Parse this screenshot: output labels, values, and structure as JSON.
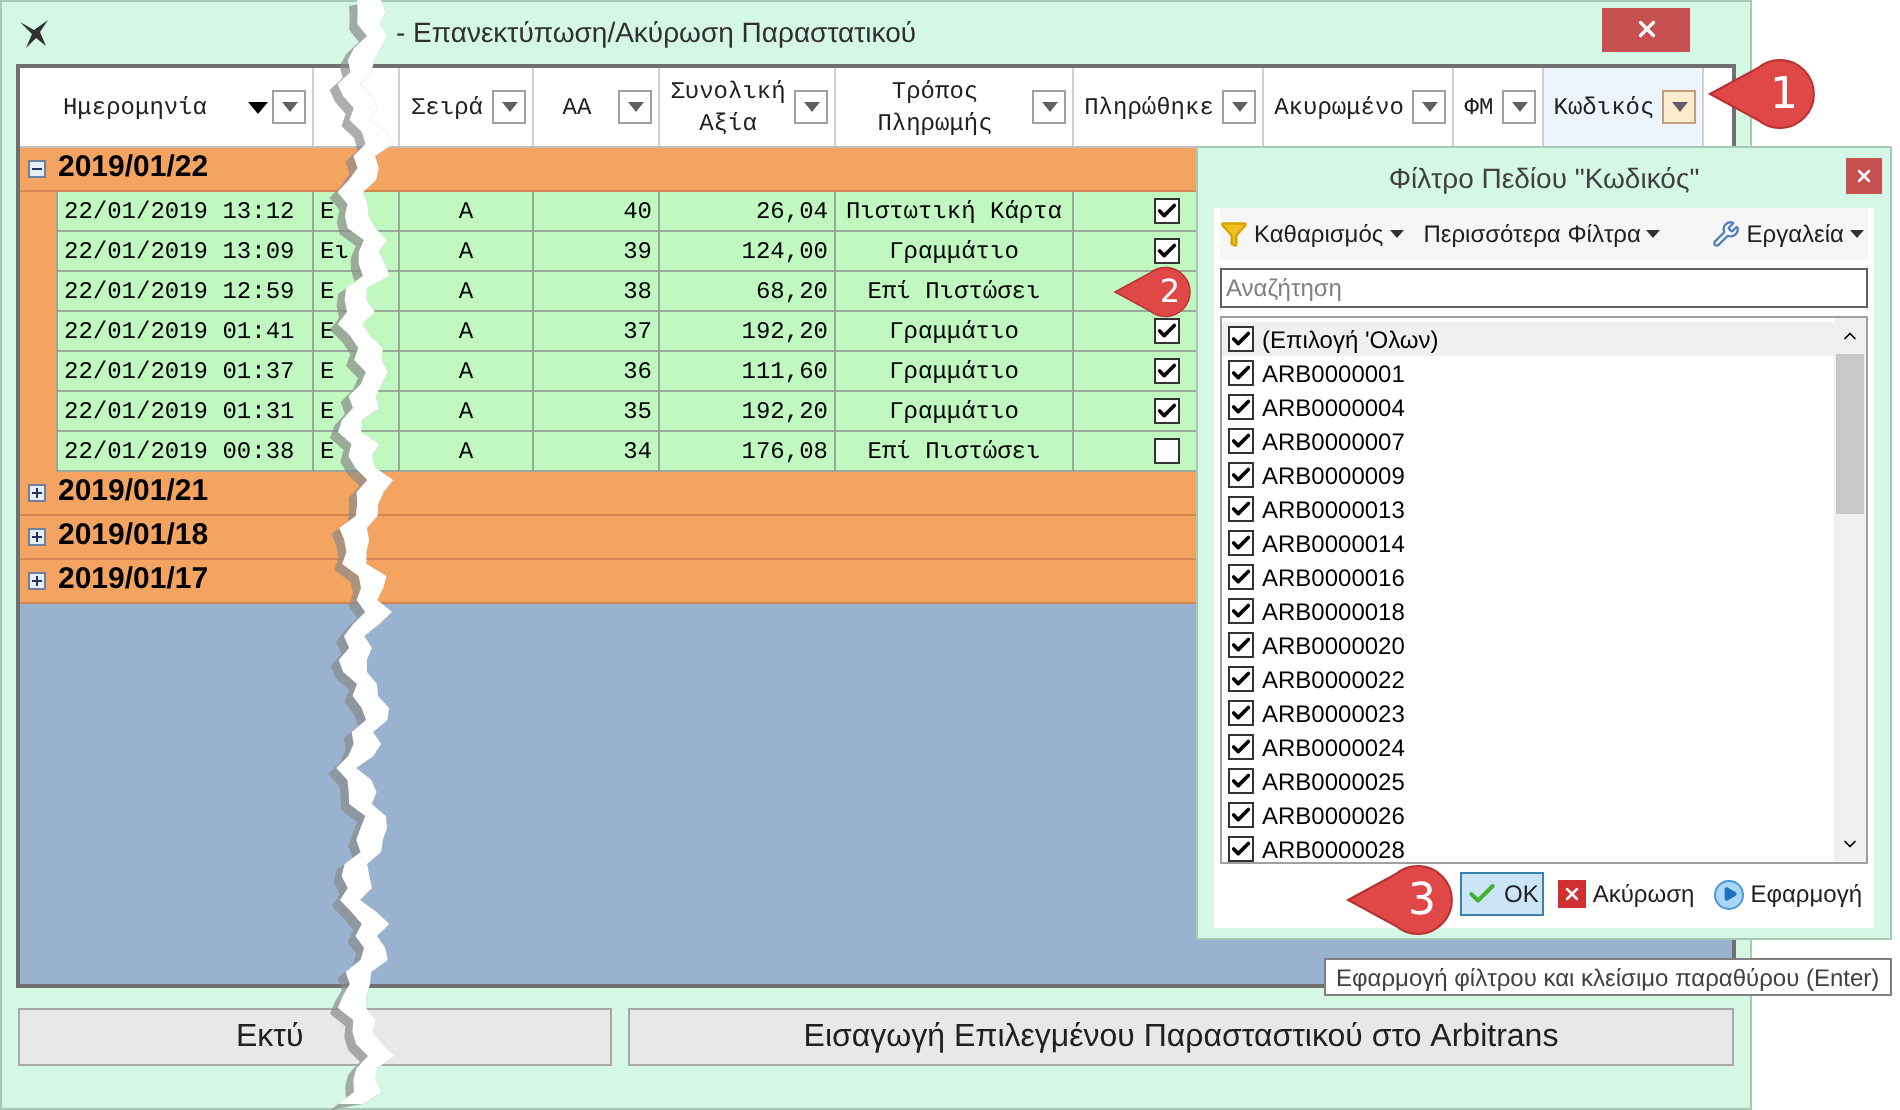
{
  "window": {
    "title": "- Επανεκτύπωση/Ακύρωση Παραστατικού"
  },
  "columns": [
    {
      "label": "Ημερομηνία",
      "sorted": true,
      "filter_open": false
    },
    {
      "label": "Σειρά",
      "sorted": false,
      "filter_open": false
    },
    {
      "label": "ΑΑ",
      "sorted": false,
      "filter_open": false
    },
    {
      "label": "Συνολική Αξία",
      "sorted": false,
      "filter_open": false
    },
    {
      "label": "Τρόπος Πληρωμής",
      "sorted": false,
      "filter_open": false
    },
    {
      "label": "Πληρώθηκε",
      "sorted": false,
      "filter_open": false
    },
    {
      "label": "Ακυρωμένο",
      "sorted": false,
      "filter_open": false
    },
    {
      "label": "ΦΜ",
      "sorted": false,
      "filter_open": false
    },
    {
      "label": "Κωδικός",
      "sorted": false,
      "filter_open": true
    }
  ],
  "groups": [
    {
      "label": "2019/01/22",
      "expanded": true,
      "rows": [
        {
          "date": "22/01/2019 13:12",
          "column_2": "Ε",
          "series": "Α",
          "number": "40",
          "total": "26,04",
          "payment": "Πιστωτική Κάρτα",
          "paid": true
        },
        {
          "date": "22/01/2019 13:09",
          "column_2": "Ει",
          "series": "Α",
          "number": "39",
          "total": "124,00",
          "payment": "Γραμμάτιο",
          "paid": true
        },
        {
          "date": "22/01/2019 12:59",
          "column_2": "Ε",
          "series": "Α",
          "number": "38",
          "total": "68,20",
          "payment": "Επί Πιστώσει"
        },
        {
          "date": "22/01/2019 01:41",
          "column_2": "Ε",
          "series": "Α",
          "number": "37",
          "total": "192,20",
          "payment": "Γραμμάτιο",
          "paid": true
        },
        {
          "date": "22/01/2019 01:37",
          "column_2": "Ε",
          "series": "Α",
          "number": "36",
          "total": "111,60",
          "payment": "Γραμμάτιο",
          "paid": true
        },
        {
          "date": "22/01/2019 01:31",
          "column_2": "Ε",
          "series": "Α",
          "number": "35",
          "total": "192,20",
          "payment": "Γραμμάτιο",
          "paid": true
        },
        {
          "date": "22/01/2019 00:38",
          "column_2": "Ε",
          "series": "Α",
          "number": "34",
          "total": "176,08",
          "payment": "Επί Πιστώσει",
          "paid": false
        }
      ]
    },
    {
      "label": "2019/01/21",
      "expanded": false
    },
    {
      "label": "2019/01/18",
      "expanded": false
    },
    {
      "label": "2019/01/17",
      "expanded": false
    }
  ],
  "buttons": [
    "Εκτύ",
    "Εισαγωγή Επιλεγμένου Παρασταστικού στο Arbitrans"
  ],
  "filter_popup": {
    "title": "Φίλτρο Πεδίου \"Κωδικός\"",
    "toolbar": [
      "Καθαρισμός",
      "Περισσότερα Φίλτρα",
      "Εργαλεία"
    ],
    "search": {
      "placeholder": "Αναζήτηση"
    },
    "items": [
      {
        "label": "(Επιλογή 'Ολων)",
        "checked": true
      },
      {
        "label": "ARB0000001",
        "checked": true
      },
      {
        "label": "ARB0000004",
        "checked": true
      },
      {
        "label": "ARB0000007",
        "checked": true
      },
      {
        "label": "ARB0000009",
        "checked": true
      },
      {
        "label": "ARB0000013",
        "checked": true
      },
      {
        "label": "ARB0000014",
        "checked": true
      },
      {
        "label": "ARB0000016",
        "checked": true
      },
      {
        "label": "ARB0000018",
        "checked": true
      },
      {
        "label": "ARB0000020",
        "checked": true
      },
      {
        "label": "ARB0000022",
        "checked": true
      },
      {
        "label": "ARB0000023",
        "checked": true
      },
      {
        "label": "ARB0000024",
        "checked": true
      },
      {
        "label": "ARB0000025",
        "checked": true
      },
      {
        "label": "ARB0000026",
        "checked": true
      },
      {
        "label": "ARB0000028",
        "checked": true
      }
    ],
    "buttons": [
      {
        "label": "OK",
        "kind": "ok",
        "selected": true
      },
      {
        "label": "Ακύρωση",
        "kind": "cancel",
        "selected": false
      },
      {
        "label": "Εφαρμογή",
        "kind": "apply",
        "selected": false
      }
    ]
  },
  "tooltip": "Εφαρμογή φίλτρου και κλείσιμο παραθύρου (Enter)",
  "callouts": [
    "1",
    "2",
    "3"
  ]
}
